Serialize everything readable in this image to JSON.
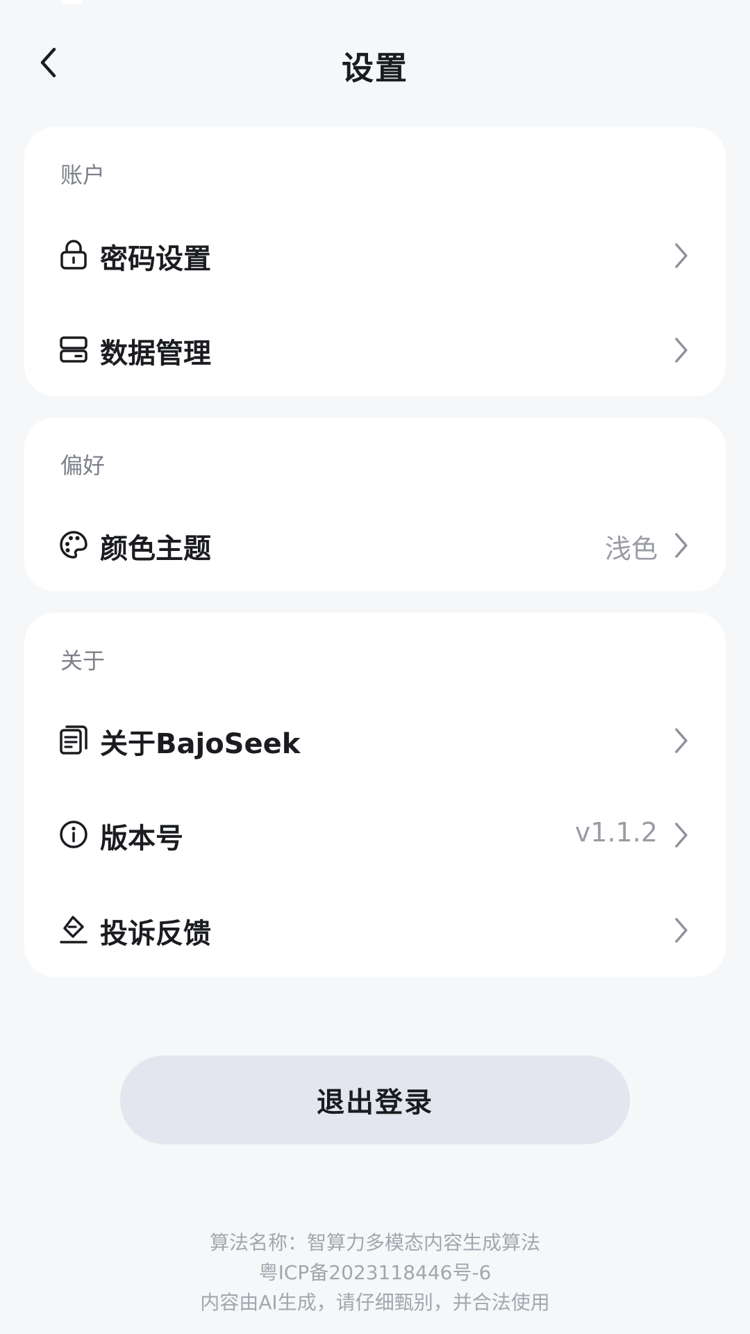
{
  "header": {
    "title": "设置"
  },
  "sections": {
    "account": {
      "label": "账户",
      "items": [
        {
          "label": "密码设置",
          "icon": "lock-icon"
        },
        {
          "label": "数据管理",
          "icon": "storage-icon"
        }
      ]
    },
    "preferences": {
      "label": "偏好",
      "items": [
        {
          "label": "颜色主题",
          "value": "浅色",
          "icon": "palette-icon"
        }
      ]
    },
    "about": {
      "label": "关于",
      "items": [
        {
          "label": "关于BajoSeek",
          "icon": "document-icon"
        },
        {
          "label": "版本号",
          "value": "v1.1.2",
          "icon": "info-icon"
        },
        {
          "label": "投诉反馈",
          "icon": "feedback-icon"
        }
      ]
    }
  },
  "logout": {
    "label": "退出登录"
  },
  "footer": {
    "line1": "算法名称：智算力多模态内容生成算法",
    "line2": "粤ICP备2023118446号-6",
    "line3": "内容由AI生成，请仔细甄别，并合法使用"
  },
  "colors": {
    "background": "#f6f7f9",
    "card": "#ffffff",
    "logout_button": "#e3e6ee",
    "primary_text": "#1a1c20",
    "secondary_text": "#7d8089",
    "value_text": "#9a9ca4"
  }
}
